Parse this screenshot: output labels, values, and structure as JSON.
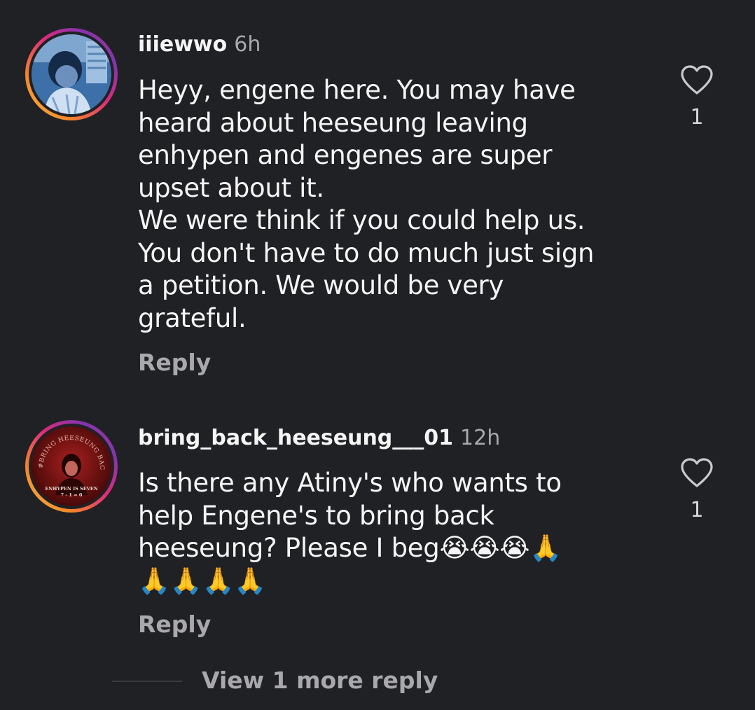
{
  "comments": [
    {
      "username": "iiiewwo",
      "time": "6h",
      "avatar_icon": "profile-photo-blue-portrait",
      "lines": [
        "Heyy, engene here. You may have",
        "heard about heeseung leaving",
        "enhypen and engenes are super",
        "upset about it.",
        "We were think if you could help us.",
        "You don't have to do much just sign",
        "a petition. We would be very",
        "grateful."
      ],
      "reply_label": "Reply",
      "like_icon": "heart-outline-icon",
      "like_count": "1"
    },
    {
      "username": "bring_back_heeseung___01",
      "time": "12h",
      "avatar_icon": "profile-photo-red-poster",
      "avatar_text_arc": "#BRING HEESEUNG BACK",
      "avatar_text_bottom_1": "ENHYPEN IS SEVEN",
      "avatar_text_bottom_2": "7 - 1 = 0",
      "lines": [
        "Is there any Atiny's who wants to",
        "help Engene's to bring back",
        "heeseung? Please I beg😭😭😭🙏",
        "🙏🙏🙏🙏"
      ],
      "reply_label": "Reply",
      "like_icon": "heart-outline-icon",
      "like_count": "1"
    }
  ],
  "view_more_label": "View 1 more reply",
  "colors": {
    "background": "#202125",
    "text_primary": "#f5f5f5",
    "text_secondary": "#a8a8ad",
    "story_ring_gradient": [
      "#f7c34a",
      "#f58529",
      "#dd2a7b",
      "#8134af"
    ]
  }
}
